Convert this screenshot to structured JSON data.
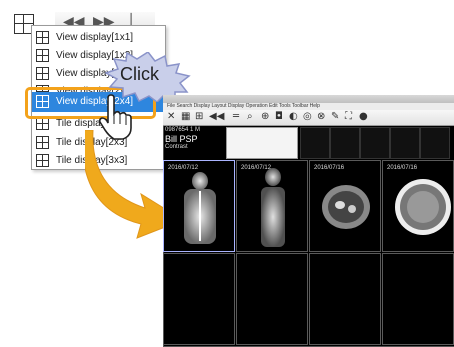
{
  "menu": {
    "items": [
      {
        "label": "View display[1x1]"
      },
      {
        "label": "View display[1x2]"
      },
      {
        "label": "View display[2x2]"
      },
      {
        "label": "View display[2x3]"
      },
      {
        "label": "View display[2x4]",
        "selected": true
      },
      {
        "label": "Tile display[2x2]"
      },
      {
        "label": "Tile display[2x3]"
      },
      {
        "label": "Tile display[3x3]"
      }
    ]
  },
  "callout": {
    "text": "Click"
  },
  "screenshot": {
    "title": "File   Search   Display   Layout   Display   Operation   Edit   Tools   Toolbar   Help",
    "patient": {
      "id": "0987654 1 M",
      "name": "Bill PSP",
      "tag": "Contrast"
    },
    "grid": {
      "dates": [
        "2016/07/12",
        "2016/07/12",
        "2016/07/16",
        "2016/07/16"
      ]
    }
  },
  "colors": {
    "highlight": "#f3a21b",
    "selected": "#2e86de",
    "arrow": "#f0a91c",
    "callout_bg": "#c9cfea"
  }
}
